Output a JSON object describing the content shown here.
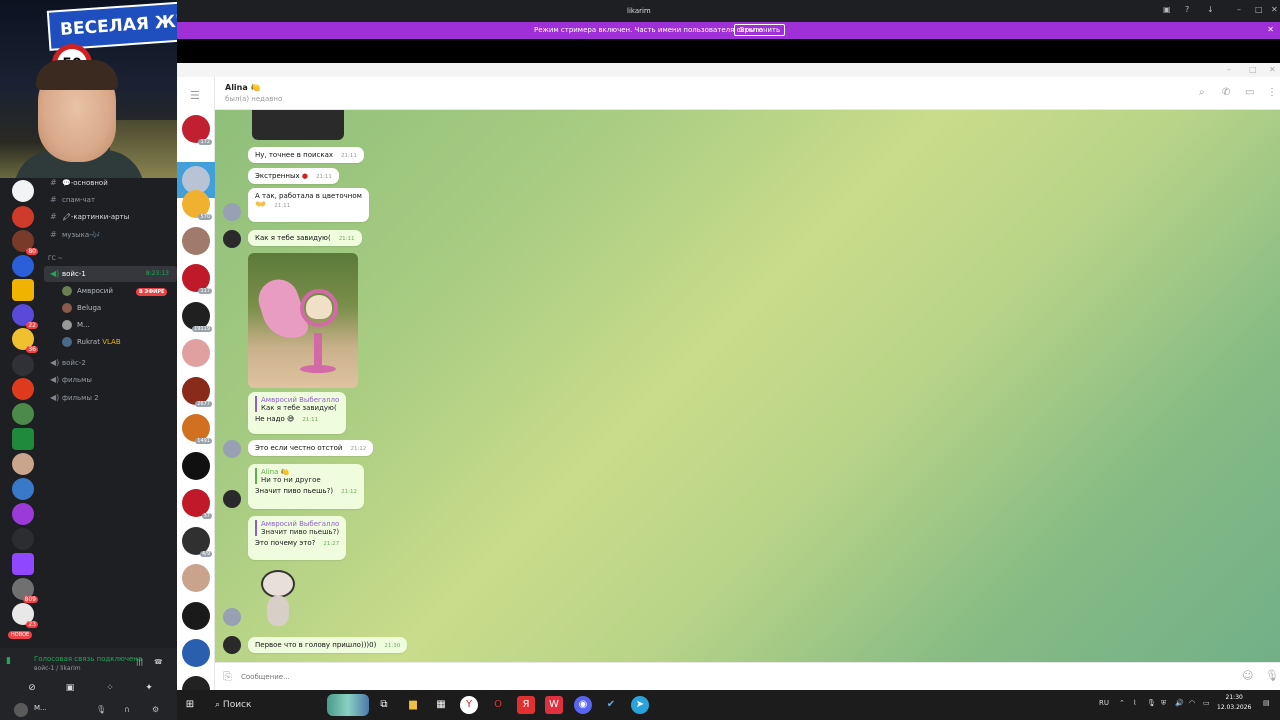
{
  "discord": {
    "webcam_sign_text": "ВЕСЕЛАЯ ЖИЗ",
    "stop_sign_text": "50",
    "channels": [
      {
        "icon": "#",
        "label": "💬-основной"
      },
      {
        "icon": "#",
        "label": "спам-чат"
      },
      {
        "icon": "#",
        "label": "🖍-картинки-арты"
      },
      {
        "icon": "#",
        "label": "музыка-🎶"
      }
    ],
    "category_label": "ГС ~",
    "voice_channel": {
      "label": "войс-1",
      "timer": "8:23:13"
    },
    "voice_users": [
      {
        "name": "Амвросий",
        "live": "В ЭФИРЕ"
      },
      {
        "name": "Beluga"
      },
      {
        "name": "М..."
      },
      {
        "name": "Rukrat",
        "tag": "VLAB"
      }
    ],
    "other_voice": [
      "войс-2",
      "фильмы",
      "фильмы 2"
    ],
    "guild_badges": [
      "80",
      "22",
      "36",
      "809",
      "23"
    ],
    "new_badge": "НОВОЕ",
    "voice_status": "Голосовая связь подключена",
    "voice_sub": "войс-1 / likarim",
    "user_name": "М..."
  },
  "window_title": "likarim",
  "streamer_bar": {
    "message": "Режим стримера включен. Часть имени пользователя скрыта.",
    "button": "Отключить"
  },
  "telegram": {
    "chat_name": "Alina 🍋",
    "chat_status": "был(а) недавно",
    "sidebar_counts": [
      "172",
      "",
      "570",
      "",
      "117",
      "19119",
      "",
      "2677",
      "1491",
      "",
      "37",
      "4/9",
      "",
      "",
      "",
      "1"
    ],
    "messages": {
      "m1": {
        "text": "Ну, точнее в поисках",
        "time": "21:11"
      },
      "m2": {
        "text": "Экстренных",
        "time": "21:11"
      },
      "m3": {
        "text": "А так, работала в цветочном",
        "time": "21:11"
      },
      "m4": {
        "text": "Как я тебе завидую(",
        "time": "21:11"
      },
      "m5": {
        "reply_name": "Амвросий Выбегалло",
        "reply_text": "Как я тебе завидую(",
        "text": "Не надо 😅",
        "time": "21:11"
      },
      "m6": {
        "text": "Это если честно отстой",
        "time": "21:12"
      },
      "m7": {
        "reply_name": "Alina 🍋",
        "reply_text": "Ни то ни другое",
        "text": "Значит пиво пьешь?)",
        "time": "21:12"
      },
      "m8": {
        "reply_name": "Амвросий Выбегалло",
        "reply_text": "Значит пиво пьешь?)",
        "text": "Это почему это?",
        "time": "21:27"
      },
      "m9": {
        "text": "Первое что в голову пришло)))0)",
        "time": "21:30"
      }
    },
    "input_placeholder": "Сообщение..."
  },
  "taskbar": {
    "search_label": "Поиск",
    "lang": "RU",
    "time": "21:30",
    "date": "12.03.2026"
  }
}
